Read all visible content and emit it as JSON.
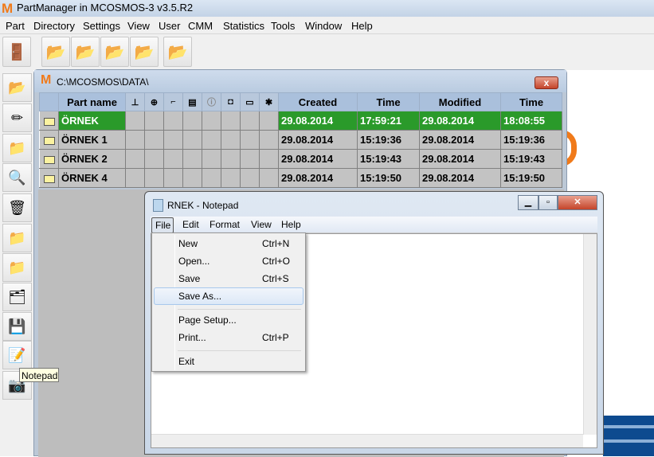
{
  "app": {
    "logo": "M",
    "title": "PartManager in MCOSMOS-3 v3.5.R2"
  },
  "menubar": [
    "Part",
    "Directory",
    "Settings",
    "View",
    "User",
    "CMM",
    "Statistics",
    "Tools",
    "Window",
    "Help"
  ],
  "toolbar": [
    "exit-icon",
    "folder-report-icon",
    "folder-icon",
    "folder-settings-icon",
    "folder-cmm-icon",
    "folder-edit-icon"
  ],
  "left_toolbar": [
    "open-folders-icon",
    "edit-icon",
    "move-icon",
    "search-icon",
    "delete-icon",
    "copy-folders-icon",
    "multi-folders-icon",
    "tree-icon",
    "save-icon",
    "notepad-icon",
    "camera-icon"
  ],
  "tooltip": "Notepad",
  "inner_window": {
    "logo": "M",
    "path": "C:\\MCOSMOS\\DATA\\",
    "close": "x",
    "columns": {
      "name": "Part name",
      "created": "Created",
      "time1": "Time",
      "modified": "Modified",
      "time2": "Time"
    },
    "icon_columns": [
      "cmm-icon",
      "probe-icon",
      "stylus-icon",
      "file-icon",
      "info-icon",
      "camera-icon",
      "window-icon",
      "gear-icon"
    ],
    "rows": [
      {
        "name": "ÖRNEK",
        "created": "29.08.2014",
        "time1": "17:59:21",
        "modified": "29.08.2014",
        "time2": "18:08:55",
        "selected": true
      },
      {
        "name": "ÖRNEK 1",
        "created": "29.08.2014",
        "time1": "15:19:36",
        "modified": "29.08.2014",
        "time2": "15:19:36"
      },
      {
        "name": "ÖRNEK 2",
        "created": "29.08.2014",
        "time1": "15:19:43",
        "modified": "29.08.2014",
        "time2": "15:19:43"
      },
      {
        "name": "ÖRNEK 4",
        "created": "29.08.2014",
        "time1": "15:19:50",
        "modified": "29.08.2014",
        "time2": "15:19:50"
      }
    ],
    "selected_color": "#2a9a2a"
  },
  "notepad": {
    "title": "RNEK - Notepad",
    "menu": [
      "File",
      "Edit",
      "Format",
      "View",
      "Help"
    ],
    "file_menu": [
      {
        "label": "New",
        "shortcut": "Ctrl+N"
      },
      {
        "label": "Open...",
        "shortcut": "Ctrl+O"
      },
      {
        "label": "Save",
        "shortcut": "Ctrl+S"
      },
      {
        "label": "Save As...",
        "shortcut": "",
        "highlighted": true
      },
      {
        "label": "Page Setup...",
        "shortcut": ""
      },
      {
        "label": "Print...",
        "shortcut": "Ctrl+P"
      },
      {
        "label": "Exit",
        "shortcut": ""
      }
    ]
  }
}
